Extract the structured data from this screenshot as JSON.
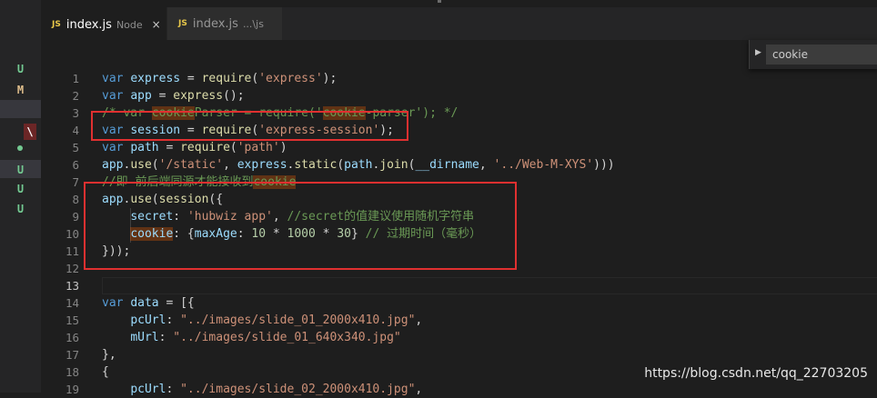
{
  "tabs": [
    {
      "lang": "JS",
      "name": "index.js",
      "desc": "Node",
      "close": "×"
    },
    {
      "lang": "JS",
      "name": "index.js",
      "desc": "...\\js"
    }
  ],
  "find": {
    "value": "cookie",
    "toggle": "▶"
  },
  "git_marks": [
    "U",
    "M",
    "U",
    "U",
    "U"
  ],
  "conflict_icon": "\\",
  "lines": [
    {
      "num": "1",
      "tokens": [
        [
          "k",
          "var "
        ],
        [
          "v",
          "express"
        ],
        [
          "p",
          " = "
        ],
        [
          "f",
          "require"
        ],
        [
          "p",
          "("
        ],
        [
          "s",
          "'express'"
        ],
        [
          "p",
          ");"
        ]
      ]
    },
    {
      "num": "2",
      "tokens": [
        [
          "k",
          "var "
        ],
        [
          "v",
          "app"
        ],
        [
          "p",
          " = "
        ],
        [
          "f",
          "express"
        ],
        [
          "p",
          "();"
        ]
      ]
    },
    {
      "num": "3",
      "tokens": [
        [
          "c",
          "/* var "
        ],
        [
          "cm",
          "cookie"
        ],
        [
          "c",
          "Parser = require('"
        ],
        [
          "cm",
          "cookie"
        ],
        [
          "c",
          "-parser'); */"
        ]
      ]
    },
    {
      "num": "4",
      "tokens": [
        [
          "k",
          "var "
        ],
        [
          "v",
          "session"
        ],
        [
          "p",
          " = "
        ],
        [
          "f",
          "require"
        ],
        [
          "p",
          "("
        ],
        [
          "s",
          "'express-session'"
        ],
        [
          "p",
          ");"
        ]
      ]
    },
    {
      "num": "5",
      "tokens": [
        [
          "k",
          "var "
        ],
        [
          "v",
          "path"
        ],
        [
          "p",
          " = "
        ],
        [
          "f",
          "require"
        ],
        [
          "p",
          "("
        ],
        [
          "s",
          "'path'"
        ],
        [
          "p",
          ")"
        ]
      ]
    },
    {
      "num": "6",
      "tokens": [
        [
          "v",
          "app"
        ],
        [
          "p",
          "."
        ],
        [
          "f",
          "use"
        ],
        [
          "p",
          "("
        ],
        [
          "s",
          "'/static'"
        ],
        [
          "p",
          ", "
        ],
        [
          "v",
          "express"
        ],
        [
          "p",
          "."
        ],
        [
          "f",
          "static"
        ],
        [
          "p",
          "("
        ],
        [
          "v",
          "path"
        ],
        [
          "p",
          "."
        ],
        [
          "f",
          "join"
        ],
        [
          "p",
          "("
        ],
        [
          "v",
          "__dirname"
        ],
        [
          "p",
          ", "
        ],
        [
          "s",
          "'../Web-M-XYS'"
        ],
        [
          "p",
          ")))"
        ]
      ]
    },
    {
      "num": "7",
      "tokens": [
        [
          "c",
          "//即 前后端同源才能接收到"
        ],
        [
          "cm",
          "cookie"
        ]
      ]
    },
    {
      "num": "8",
      "tokens": [
        [
          "v",
          "app"
        ],
        [
          "p",
          "."
        ],
        [
          "f",
          "use"
        ],
        [
          "p",
          "("
        ],
        [
          "f",
          "session"
        ],
        [
          "p",
          "({"
        ]
      ]
    },
    {
      "num": "9",
      "tokens": [
        [
          "p",
          "    "
        ],
        [
          "v",
          "secret"
        ],
        [
          "p",
          ": "
        ],
        [
          "s",
          "'hubwiz app'"
        ],
        [
          "p",
          ", "
        ],
        [
          "c",
          "//secret的值建议使用随机字符串"
        ]
      ]
    },
    {
      "num": "10",
      "tokens": [
        [
          "p",
          "    "
        ],
        [
          "vm",
          "cookie"
        ],
        [
          "p",
          ": {"
        ],
        [
          "v",
          "maxAge"
        ],
        [
          "p",
          ": "
        ],
        [
          "n",
          "10"
        ],
        [
          "p",
          " * "
        ],
        [
          "n",
          "1000"
        ],
        [
          "p",
          " * "
        ],
        [
          "n",
          "30"
        ],
        [
          "p",
          "} "
        ],
        [
          "c",
          "// 过期时间（毫秒）"
        ]
      ]
    },
    {
      "num": "11",
      "tokens": [
        [
          "p",
          "}));"
        ]
      ]
    },
    {
      "num": "12",
      "tokens": []
    },
    {
      "num": "13",
      "tokens": []
    },
    {
      "num": "14",
      "tokens": [
        [
          "k",
          "var "
        ],
        [
          "v",
          "data"
        ],
        [
          "p",
          " = [{"
        ]
      ]
    },
    {
      "num": "15",
      "tokens": [
        [
          "p",
          "    "
        ],
        [
          "v",
          "pcUrl"
        ],
        [
          "p",
          ": "
        ],
        [
          "s",
          "\"../images/slide_01_2000x410.jpg\""
        ],
        [
          "p",
          ","
        ]
      ]
    },
    {
      "num": "16",
      "tokens": [
        [
          "p",
          "    "
        ],
        [
          "v",
          "mUrl"
        ],
        [
          "p",
          ": "
        ],
        [
          "s",
          "\"../images/slide_01_640x340.jpg\""
        ]
      ]
    },
    {
      "num": "17",
      "tokens": [
        [
          "p",
          "},"
        ]
      ]
    },
    {
      "num": "18",
      "tokens": [
        [
          "p",
          "{"
        ]
      ]
    },
    {
      "num": "19",
      "tokens": [
        [
          "p",
          "    "
        ],
        [
          "v",
          "pcUrl"
        ],
        [
          "p",
          ": "
        ],
        [
          "s",
          "\"../images/slide_02_2000x410.jpg\""
        ],
        [
          "p",
          ","
        ]
      ]
    }
  ],
  "current_line": "13",
  "watermark": "https://blog.csdn.net/qq_22703205"
}
